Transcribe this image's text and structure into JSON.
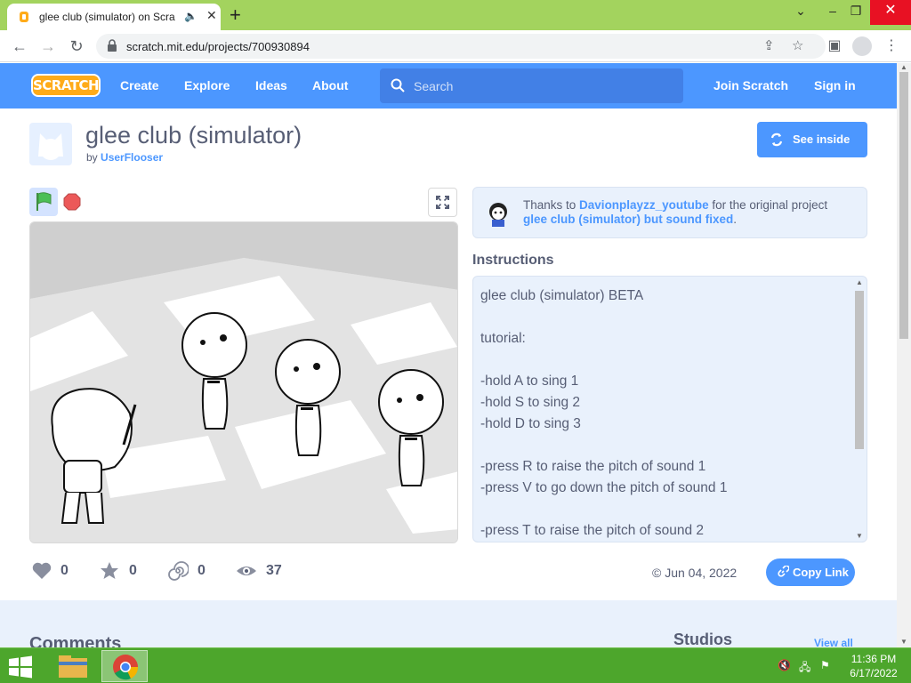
{
  "browser": {
    "tab_title": "glee club (simulator) on Scra",
    "url": "scratch.mit.edu/projects/700930894",
    "new_tab": "+",
    "minimize": "⌄",
    "restore": "–",
    "close": "✕"
  },
  "nav": {
    "logo": "SCRATCH",
    "create": "Create",
    "explore": "Explore",
    "ideas": "Ideas",
    "about": "About",
    "search_placeholder": "Search",
    "join": "Join Scratch",
    "signin": "Sign in"
  },
  "project": {
    "title": "glee club (simulator)",
    "by_prefix": "by",
    "author": "UserFlooser",
    "see_inside": "See inside"
  },
  "credits": {
    "thanks_prefix": "Thanks to",
    "credit_user": "Davionplayzz_youtube",
    "mid_text": "for the original project",
    "original_project": "glee club (simulator) but sound fixed",
    "end": "."
  },
  "instructions": {
    "heading": "Instructions",
    "text": "glee club (simulator) BETA\n\ntutorial:\n\n-hold A to sing 1\n-hold S to sing 2\n-hold D to sing 3\n\n-press R to raise the pitch of sound 1\n-press V to go down the pitch of sound 1\n\n-press T to raise the pitch of sound 2"
  },
  "stats": {
    "loves": "0",
    "favorites": "0",
    "remixes": "0",
    "views": "37"
  },
  "shared_date": "© Jun 04, 2022",
  "copy_link": "Copy Link",
  "lower": {
    "comments": "Comments",
    "studios": "Studios",
    "view_all": "View all"
  },
  "taskbar": {
    "time": "11:36 PM",
    "date": "6/17/2022"
  },
  "colors": {
    "scratch_blue": "#4c97ff",
    "scratch_orange": "#ffab19",
    "chrome_frame": "#a3d35e",
    "taskbar": "#4da62c"
  }
}
